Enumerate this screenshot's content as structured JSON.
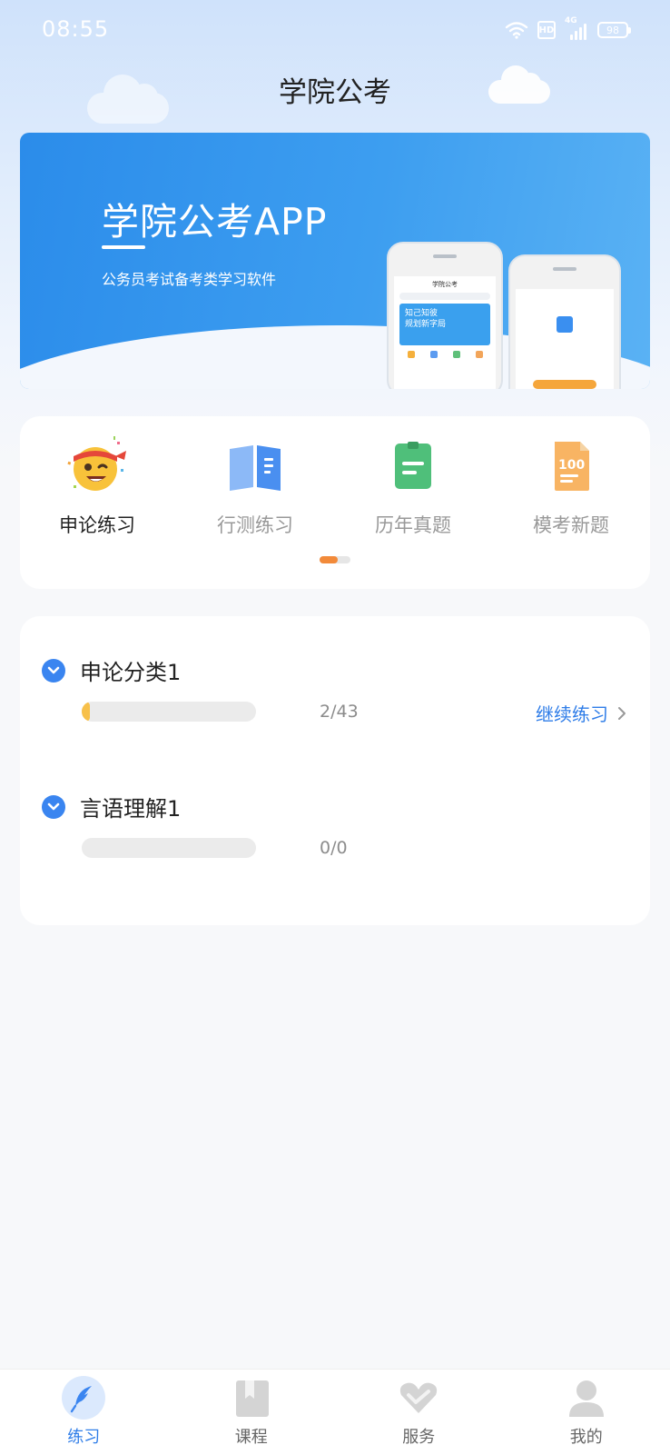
{
  "status_bar": {
    "time": "08:55",
    "hd": "HD",
    "network": "4G",
    "battery": "98"
  },
  "header": {
    "title": "学院公考"
  },
  "banner": {
    "title": "学院公考APP",
    "subtitle": "公务员考试备考类学习软件",
    "phone_title": "学院公考",
    "phone_banner_text_1": "知己知彼",
    "phone_banner_text_2": "规划新字局"
  },
  "categories": [
    {
      "label": "申论练习",
      "icon": "emoji-headband-icon",
      "active": true
    },
    {
      "label": "行测练习",
      "icon": "open-book-icon",
      "active": false
    },
    {
      "label": "历年真题",
      "icon": "document-icon",
      "active": false
    },
    {
      "label": "模考新题",
      "icon": "score-paper-icon",
      "active": false
    }
  ],
  "sections": [
    {
      "title": "申论分类1",
      "count": "2/43",
      "progress": 0.0465,
      "action": "继续练习"
    },
    {
      "title": "言语理解1",
      "count": "0/0",
      "progress": 0
    }
  ],
  "bottom_nav": [
    {
      "label": "练习",
      "icon": "feather-icon",
      "active": true
    },
    {
      "label": "课程",
      "icon": "bookmark-book-icon",
      "active": false
    },
    {
      "label": "服务",
      "icon": "handshake-heart-icon",
      "active": false
    },
    {
      "label": "我的",
      "icon": "user-icon",
      "active": false
    }
  ],
  "colors": {
    "accent": "#2f7de8",
    "progress_fill": "#f7c04a",
    "indicator": "#f28a3a"
  }
}
